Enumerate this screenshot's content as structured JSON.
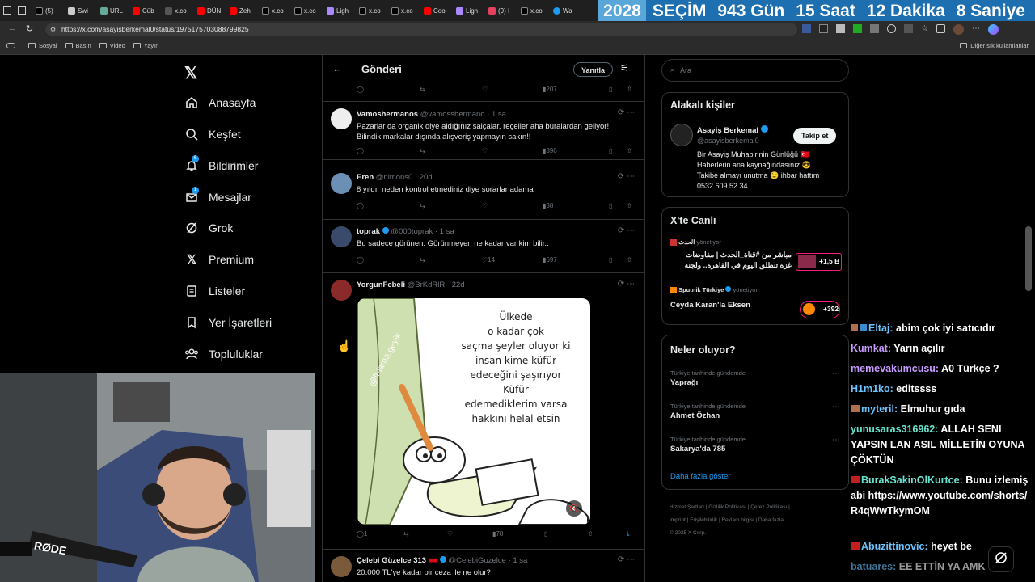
{
  "browser": {
    "tabs": [
      "(5)",
      "Swi",
      "URL",
      "Cüb",
      "x.co",
      "DÜN",
      "Zeh",
      "x.co",
      "x.co",
      "Ligh",
      "x.co",
      "x.co",
      "Coo",
      "Ligh",
      "(9) I",
      "x.co",
      "Wa"
    ],
    "url": "https://x.com/asayisberkemal0/status/1975175703088799825",
    "bookmarks": [
      "Sosyal",
      "Basın",
      "Video",
      "Yayın"
    ],
    "bookmarks_right": "Diğer sık kullanılanlar"
  },
  "countdown": {
    "year": "2028",
    "label": "SEÇİM",
    "days": "943",
    "days_unit": "Gün",
    "hours": "15",
    "hours_unit": "Saat",
    "minutes": "12",
    "minutes_unit": "Dakika",
    "seconds": "8",
    "seconds_unit": "Saniye"
  },
  "sidebar": {
    "items": [
      {
        "label": "Anasayfa",
        "icon": "home-icon"
      },
      {
        "label": "Keşfet",
        "icon": "search-icon"
      },
      {
        "label": "Bildirimler",
        "icon": "bell-icon"
      },
      {
        "label": "Mesajlar",
        "icon": "mail-icon"
      },
      {
        "label": "Grok",
        "icon": "grok-icon"
      },
      {
        "label": "Premium",
        "icon": "x-icon"
      },
      {
        "label": "Listeler",
        "icon": "list-icon"
      },
      {
        "label": "Yer İşaretleri",
        "icon": "bookmark-icon"
      },
      {
        "label": "Topluluklar",
        "icon": "people-icon"
      }
    ],
    "notif_badge": "6",
    "msg_badge": "1"
  },
  "header": {
    "title": "Gönderi",
    "reply_button": "Yanıtla"
  },
  "top_actions": {
    "views": "207"
  },
  "tweets": [
    {
      "name": "Vamoshermanos",
      "handle": "@vamosshermano",
      "time": "· 1 sa",
      "text": "Pazarlar da organik diye aldığınız salçalar, reçeller aha buralardan geliyor! Bilindik markalar dışında alışveriş yapmayın sakın!!",
      "replies": "",
      "reposts": "",
      "likes": "",
      "views": "396"
    },
    {
      "name": "Eren",
      "handle": "@nimons0",
      "time": "· 20d",
      "text": "8 yıldır neden kontrol etmediniz diye sorarlar adama",
      "replies": "",
      "reposts": "",
      "likes": "",
      "views": "38"
    },
    {
      "name": "toprak",
      "handle": "@000toprak",
      "time": "· 1 sa",
      "text": "Bu sadece görünen.  Görünmeyen ne kadar var kim bilir..",
      "replies": "",
      "reposts": "",
      "likes": "14",
      "views": "697"
    },
    {
      "name": "YorgunFebeli",
      "handle": "@BrKdRlR",
      "time": "· 22d",
      "text": "",
      "replies": "1",
      "reposts": "",
      "likes": "",
      "views": "78"
    },
    {
      "name": "Çelebi Güzelce 313",
      "handle": "@CelebiGuzelce",
      "time": "· 1 sa",
      "text": "20.000 TL'ye kadar bir ceza ile ne olur?",
      "replies": "",
      "reposts": "",
      "likes": "",
      "views": ""
    }
  ],
  "image_text": {
    "watermark": "@fi-lama.geyik",
    "lines": [
      "Ülkede",
      "o kadar çok",
      "saçma şeyler oluyor ki",
      "insan kime küfür",
      "edeceğini şaşırıyor",
      "Küfür",
      "edemediklerim varsa",
      "hakkını helal etsin"
    ]
  },
  "search": {
    "placeholder": "Ara"
  },
  "related": {
    "title": "Alakalı kişiler",
    "name": "Asayiş Berkemal",
    "handle": "@asayisberkemal0",
    "follow": "Takip et",
    "bio": [
      "Bir Asayiş Muhabirinin Günlüğü 🇹🇷",
      "Haberlerin ana kaynağındasınız 😎",
      "Takibe almayı unutma 😉 ihbar hattım",
      "0532 609 52 34"
    ]
  },
  "live": {
    "title": "X'te Canlı",
    "items": [
      {
        "host": "الحدث",
        "role": "yönetiyor",
        "text1": "مباشر من #قناة_الحدث | مفاوضات",
        "text2": "غزة تنطلق اليوم في القاهرة.. ولجنة",
        "count": "+1,5 B"
      },
      {
        "host": "Sputnik Türkiye",
        "role": "yönetiyor",
        "text1": "Ceyda Karan'la Eksen",
        "text2": "",
        "count": "+392"
      }
    ]
  },
  "trends": {
    "title": "Neler oluyor?",
    "items": [
      {
        "context": "Türkiye tarihinde gündemde",
        "topic": "Yaprağı"
      },
      {
        "context": "Türkiye tarihinde gündemde",
        "topic": "Ahmet Özhan"
      },
      {
        "context": "Türkiye tarihinde gündemde",
        "topic": "Sakarya'da 785"
      }
    ],
    "more": "Daha fazla göster"
  },
  "footer": {
    "links": [
      "Hizmet Şartları",
      "Gizlilik Politikası",
      "Çerez Politikası",
      "Imprint",
      "Erişilebilirlik",
      "Reklam bilgisi",
      "Daha fazla ..."
    ],
    "copyright": "© 2025 X Corp."
  },
  "chat": [
    {
      "user": "Eltaj:",
      "msg": "abim çok iyi satıcıdır"
    },
    {
      "user": "Kumkat:",
      "msg": "Yarın açılır"
    },
    {
      "user": "memevakumcusu:",
      "msg": "A0 Türkçe ?"
    },
    {
      "user": "H1m1ko:",
      "msg": "editssss"
    },
    {
      "user": "myteril:",
      "msg": "Elmuhur gıda"
    },
    {
      "user": "yunusaras316962:",
      "msg": "ALLAH SENI YAPSIN LAN ASIL MİLLETİN OYUNA ÇÖKTÜN"
    },
    {
      "user": "BurakSakinOlKurtce:",
      "msg": "Bunu izlemiş abi https://www.youtube.com/shorts/R4qWwTkymOM"
    },
    {
      "user": "Abuzittinovic:",
      "msg": "heyet be"
    },
    {
      "user": "batuares:",
      "msg": "EE ETTİN YA AMK"
    }
  ],
  "colors": {
    "accent": "#1d9bf0",
    "countdown_bg": "#1d6fb0",
    "live_red": "#f91880"
  }
}
